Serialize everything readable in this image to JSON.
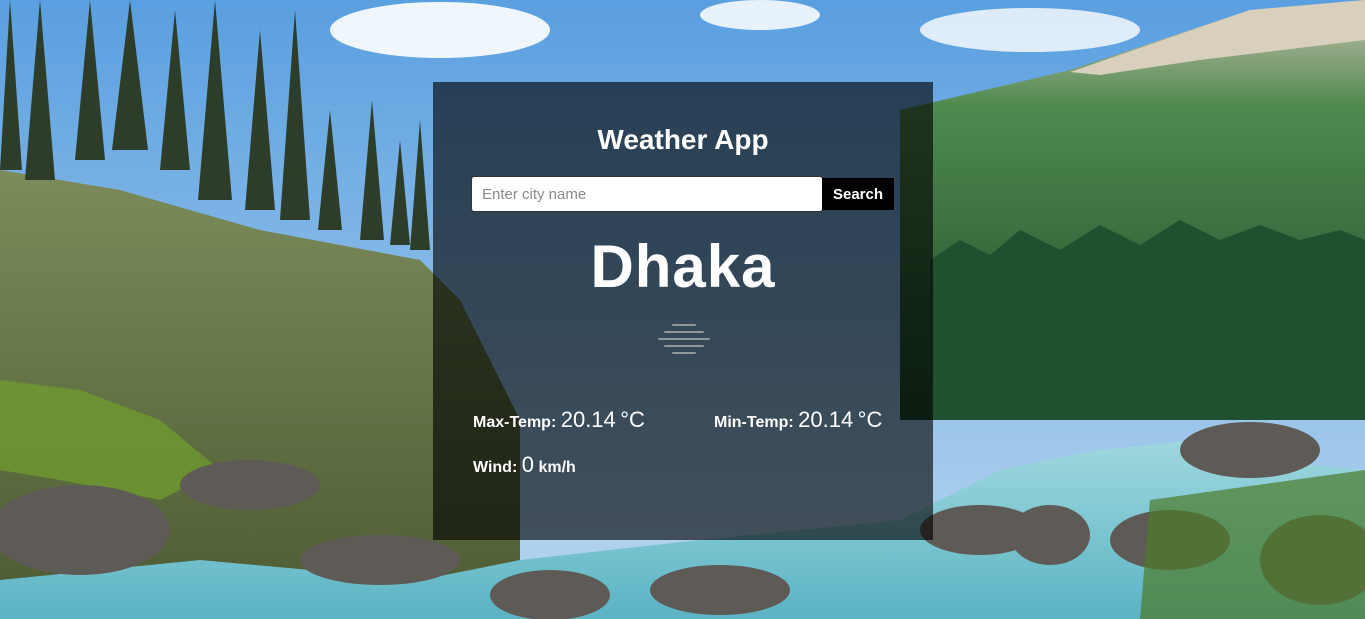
{
  "app": {
    "title": "Weather App"
  },
  "search": {
    "placeholder": "Enter city name",
    "value": "",
    "button_label": "Search"
  },
  "weather": {
    "city": "Dhaka",
    "icon": "mist-icon",
    "max_temp_label": "Max-Temp:",
    "max_temp_value": "20.14",
    "max_temp_unit": "°C",
    "min_temp_label": "Min-Temp:",
    "min_temp_value": "20.14",
    "min_temp_unit": "°C",
    "wind_label": "Wind:",
    "wind_value": "0",
    "wind_unit": "km/h"
  },
  "background": {
    "image": "mountain-river-forest-landscape"
  }
}
